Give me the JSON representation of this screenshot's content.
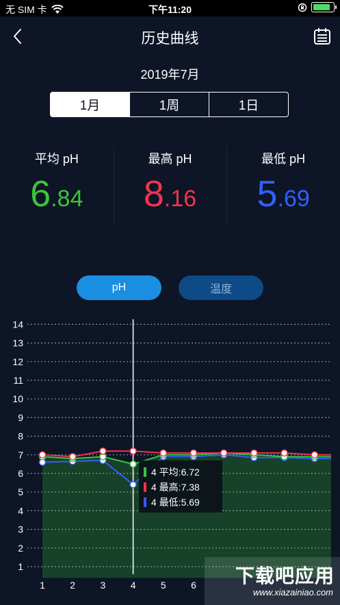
{
  "status_bar": {
    "carrier": "无 SIM 卡",
    "time": "下午11:20",
    "battery_level": 0.9
  },
  "nav": {
    "title": "历史曲线",
    "back_icon": "chevron-left-icon",
    "calendar_icon": "calendar-icon"
  },
  "date_label": "2019年7月",
  "segments": [
    {
      "label": "1月",
      "active": true
    },
    {
      "label": "1周",
      "active": false
    },
    {
      "label": "1日",
      "active": false
    }
  ],
  "stats": [
    {
      "label": "平均 pH",
      "int": "6",
      "dec": ".84",
      "color": "#3cc43c"
    },
    {
      "label": "最高 pH",
      "int": "8",
      "dec": ".16",
      "color": "#f0344e"
    },
    {
      "label": "最低 pH",
      "int": "5",
      "dec": ".69",
      "color": "#2f5fff"
    }
  ],
  "toggles": {
    "ph_label": "pH",
    "temp_label": "温度"
  },
  "chart_data": {
    "type": "line",
    "x": [
      1,
      2,
      3,
      4,
      5,
      6,
      7,
      8,
      9,
      10
    ],
    "xticks": [
      "1",
      "2",
      "3",
      "4",
      "5",
      "6"
    ],
    "yticks": [
      "1",
      "2",
      "3",
      "4",
      "5",
      "6",
      "7",
      "8",
      "9",
      "10",
      "11",
      "12",
      "13",
      "14"
    ],
    "ylim": [
      0.4,
      14
    ],
    "grid": true,
    "series": [
      {
        "key": "avg",
        "color": "#3cc43c",
        "values": [
          6.9,
          6.8,
          6.9,
          6.5,
          7.0,
          7.0,
          7.1,
          7.0,
          6.9,
          6.9
        ]
      },
      {
        "key": "max",
        "color": "#f0344e",
        "values": [
          7.0,
          6.9,
          7.2,
          7.2,
          7.1,
          7.1,
          7.1,
          7.1,
          7.1,
          7.0
        ]
      },
      {
        "key": "min",
        "color": "#2f5fff",
        "values": [
          6.6,
          6.65,
          6.7,
          5.4,
          6.9,
          6.9,
          7.0,
          6.85,
          6.85,
          6.8
        ]
      }
    ],
    "cursor_x": 4,
    "tooltip": [
      {
        "text": "4 平均:6.72",
        "color": "#3cc43c"
      },
      {
        "text": "4 最高:7.38",
        "color": "#f0344e"
      },
      {
        "text": "4 最低:5.69",
        "color": "#2f5fff"
      }
    ]
  },
  "watermark": {
    "title": "下载吧应用",
    "url": "www.xiazainiao.com"
  }
}
